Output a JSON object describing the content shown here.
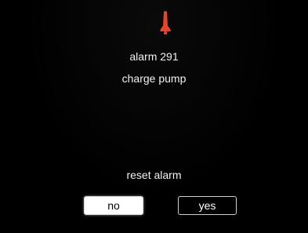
{
  "alarm": {
    "icon": "alarm-bell-icon",
    "icon_color": "#e8442a",
    "title": "alarm 291",
    "description": "charge pump"
  },
  "dialog": {
    "prompt": "reset alarm",
    "no_label": "no",
    "yes_label": "yes"
  },
  "colors": {
    "background": "#000000",
    "text": "#f2f2f2",
    "selected_button_bg": "#ffffff"
  }
}
